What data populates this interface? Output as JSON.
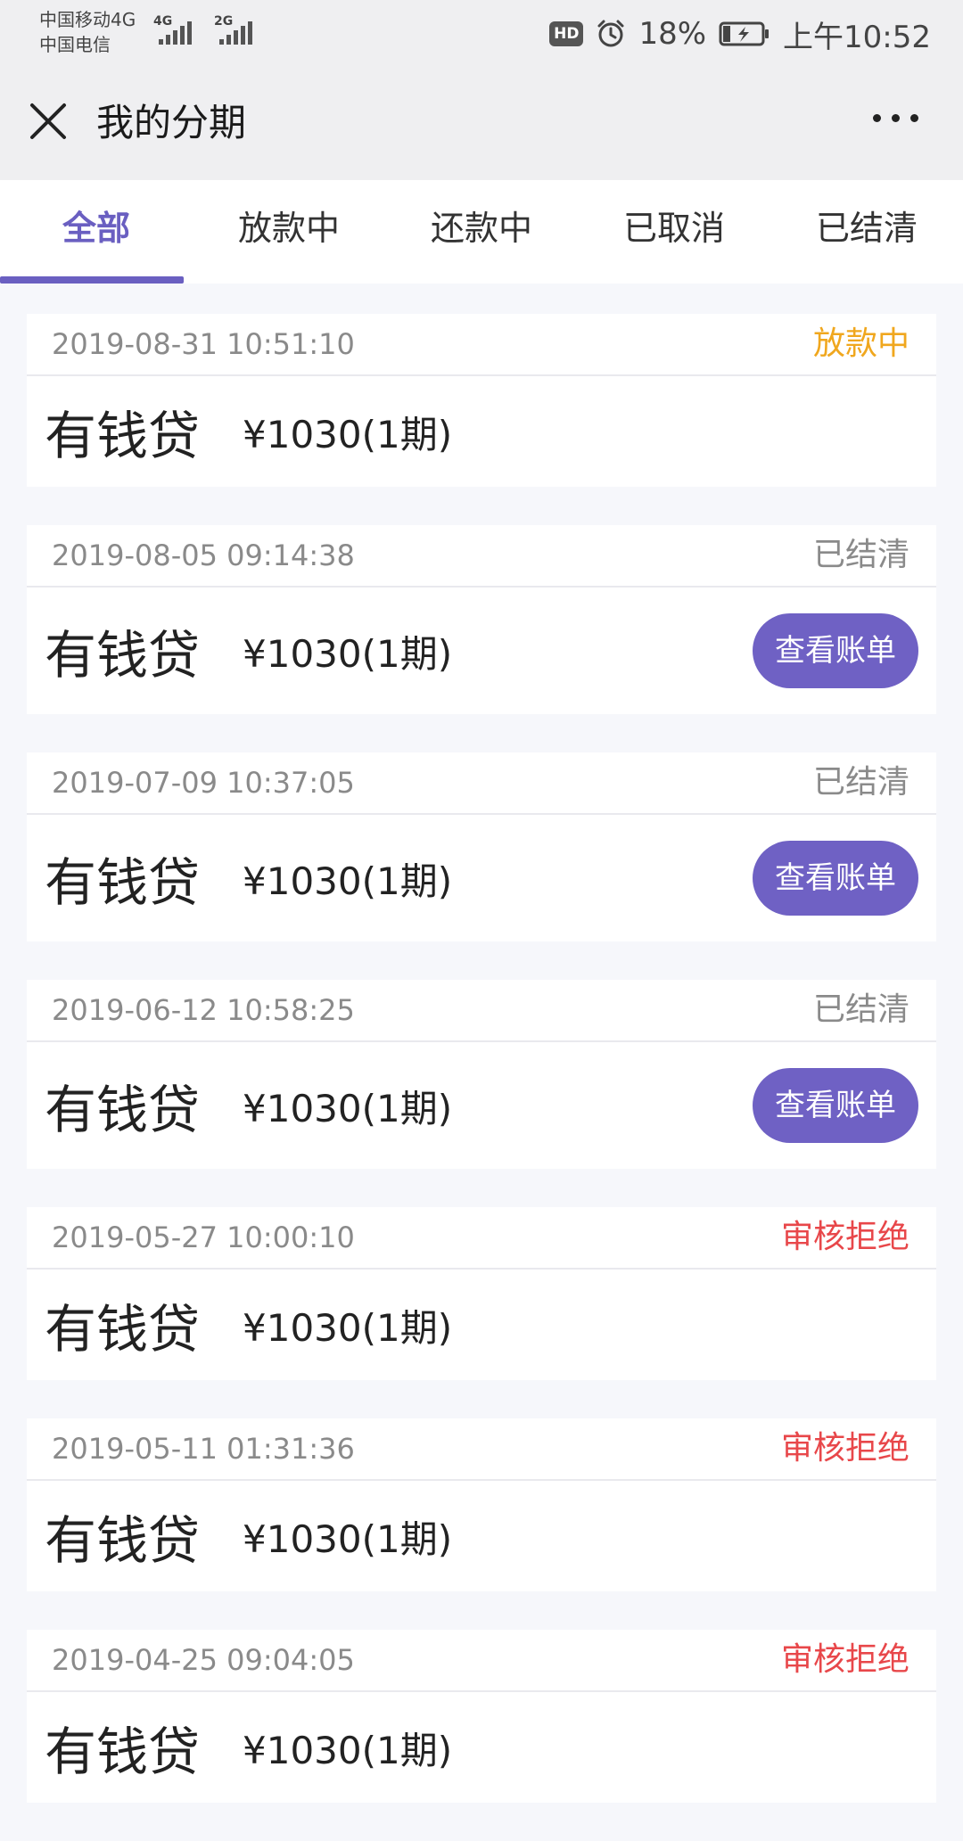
{
  "statusbar": {
    "carrier1": "中国移动4G",
    "carrier2": "中国电信",
    "sig1_tag": "4G",
    "sig2_tag": "2G",
    "hd": "HD",
    "battery": "18%",
    "time": "上午10:52"
  },
  "header": {
    "title": "我的分期"
  },
  "tabs": [
    {
      "label": "全部"
    },
    {
      "label": "放款中"
    },
    {
      "label": "还款中"
    },
    {
      "label": "已取消"
    },
    {
      "label": "已结清"
    }
  ],
  "colors": {
    "accent": "#6a5fc1",
    "status_pending": "#f0a71e",
    "status_settled": "#8a8a8a",
    "status_rejected": "#e8474a"
  },
  "bill_button_label": "查看账单",
  "records": [
    {
      "time": "2019-08-31 10:51:10",
      "status": "放款中",
      "product": "有钱贷",
      "amount": "¥1030(1期)"
    },
    {
      "time": "2019-08-05 09:14:38",
      "status": "已结清",
      "product": "有钱贷",
      "amount": "¥1030(1期)"
    },
    {
      "time": "2019-07-09 10:37:05",
      "status": "已结清",
      "product": "有钱贷",
      "amount": "¥1030(1期)"
    },
    {
      "time": "2019-06-12 10:58:25",
      "status": "已结清",
      "product": "有钱贷",
      "amount": "¥1030(1期)"
    },
    {
      "time": "2019-05-27 10:00:10",
      "status": "审核拒绝",
      "product": "有钱贷",
      "amount": "¥1030(1期)"
    },
    {
      "time": "2019-05-11 01:31:36",
      "status": "审核拒绝",
      "product": "有钱贷",
      "amount": "¥1030(1期)"
    },
    {
      "time": "2019-04-25 09:04:05",
      "status": "审核拒绝",
      "product": "有钱贷",
      "amount": "¥1030(1期)"
    }
  ]
}
